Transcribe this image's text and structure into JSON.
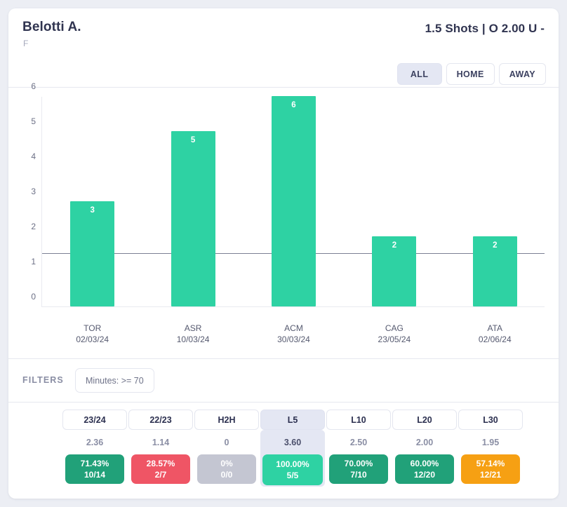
{
  "header": {
    "player_name": "Belotti A.",
    "player_position": "F",
    "market_line": "1.5 Shots | O 2.00 U -",
    "venue_filters": [
      {
        "label": "ALL",
        "active": true
      },
      {
        "label": "HOME",
        "active": false
      },
      {
        "label": "AWAY",
        "active": false
      }
    ]
  },
  "filters": {
    "label": "FILTERS",
    "chips": [
      {
        "label": "Minutes: >= 70"
      }
    ]
  },
  "periods": {
    "columns": [
      {
        "tab": "23/24",
        "odds": "2.36",
        "percent": "71.43%",
        "ratio": "10/14",
        "color": "#21a179",
        "active": false
      },
      {
        "tab": "22/23",
        "odds": "1.14",
        "percent": "28.57%",
        "ratio": "2/7",
        "color": "#ef5565",
        "active": false
      },
      {
        "tab": "H2H",
        "odds": "0",
        "percent": "0%",
        "ratio": "0/0",
        "color": "#c4c6d2",
        "active": false
      },
      {
        "tab": "L5",
        "odds": "3.60",
        "percent": "100.00%",
        "ratio": "5/5",
        "color": "#2ed2a3",
        "active": true
      },
      {
        "tab": "L10",
        "odds": "2.50",
        "percent": "70.00%",
        "ratio": "7/10",
        "color": "#21a179",
        "active": false
      },
      {
        "tab": "L20",
        "odds": "2.00",
        "percent": "60.00%",
        "ratio": "12/20",
        "color": "#21a179",
        "active": false
      },
      {
        "tab": "L30",
        "odds": "1.95",
        "percent": "57.14%",
        "ratio": "12/21",
        "color": "#f6a013",
        "active": false
      }
    ]
  },
  "chart_data": {
    "type": "bar",
    "title": "",
    "xlabel": "",
    "ylabel": "",
    "ylim": [
      0,
      6
    ],
    "yticks": [
      0,
      1,
      2,
      3,
      4,
      5,
      6
    ],
    "grid": false,
    "legend": false,
    "bar_color": "#2ed2a3",
    "threshold": {
      "value": 1.5,
      "color": "#7b7f93"
    },
    "categories": [
      "TOR",
      "ASR",
      "ACM",
      "CAG",
      "ATA"
    ],
    "category_dates": [
      "02/03/24",
      "10/03/24",
      "30/03/24",
      "23/05/24",
      "02/06/24"
    ],
    "values": [
      3,
      5,
      6,
      2,
      2
    ],
    "value_labels": [
      "3",
      "5",
      "6",
      "2",
      "2"
    ]
  }
}
